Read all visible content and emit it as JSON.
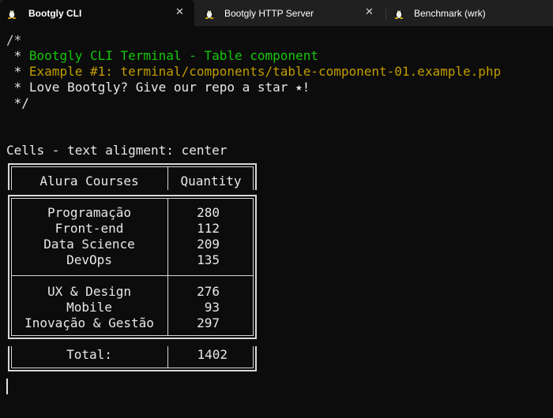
{
  "tabs": [
    {
      "title": "Bootgly CLI",
      "active": true
    },
    {
      "title": "Bootgly HTTP Server",
      "active": false
    },
    {
      "title": "Benchmark (wrk)",
      "active": false
    }
  ],
  "close_glyph": "✕",
  "terminal": {
    "comment_open": "/*",
    "line1_prefix": " * ",
    "line1_text": "Bootgly CLI Terminal - Table component",
    "line2_prefix": " * ",
    "line2_text": "Example #1: terminal/components/table-component-01.example.php",
    "line3": " * Love Bootgly? Give our repo a star ⭑!",
    "comment_close": " */",
    "section_heading": "Cells - text aligment: center"
  },
  "table": {
    "headers": [
      "Alura Courses",
      "Quantity"
    ],
    "groups": [
      [
        {
          "course": "Programação",
          "qty": "280"
        },
        {
          "course": "Front-end",
          "qty": "112"
        },
        {
          "course": "Data Science",
          "qty": "209"
        },
        {
          "course": "DevOps",
          "qty": "135"
        }
      ],
      [
        {
          "course": "UX & Design",
          "qty": "276"
        },
        {
          "course": "Mobile",
          "qty": "93"
        },
        {
          "course": "Inovação & Gestão",
          "qty": "297"
        }
      ]
    ],
    "footer": [
      "Total:",
      "1402"
    ]
  },
  "colors": {
    "background": "#0c0c0c",
    "tabbar": "#202020",
    "green": "#16c60c",
    "yellow": "#c19c00",
    "text": "#cccccc"
  }
}
